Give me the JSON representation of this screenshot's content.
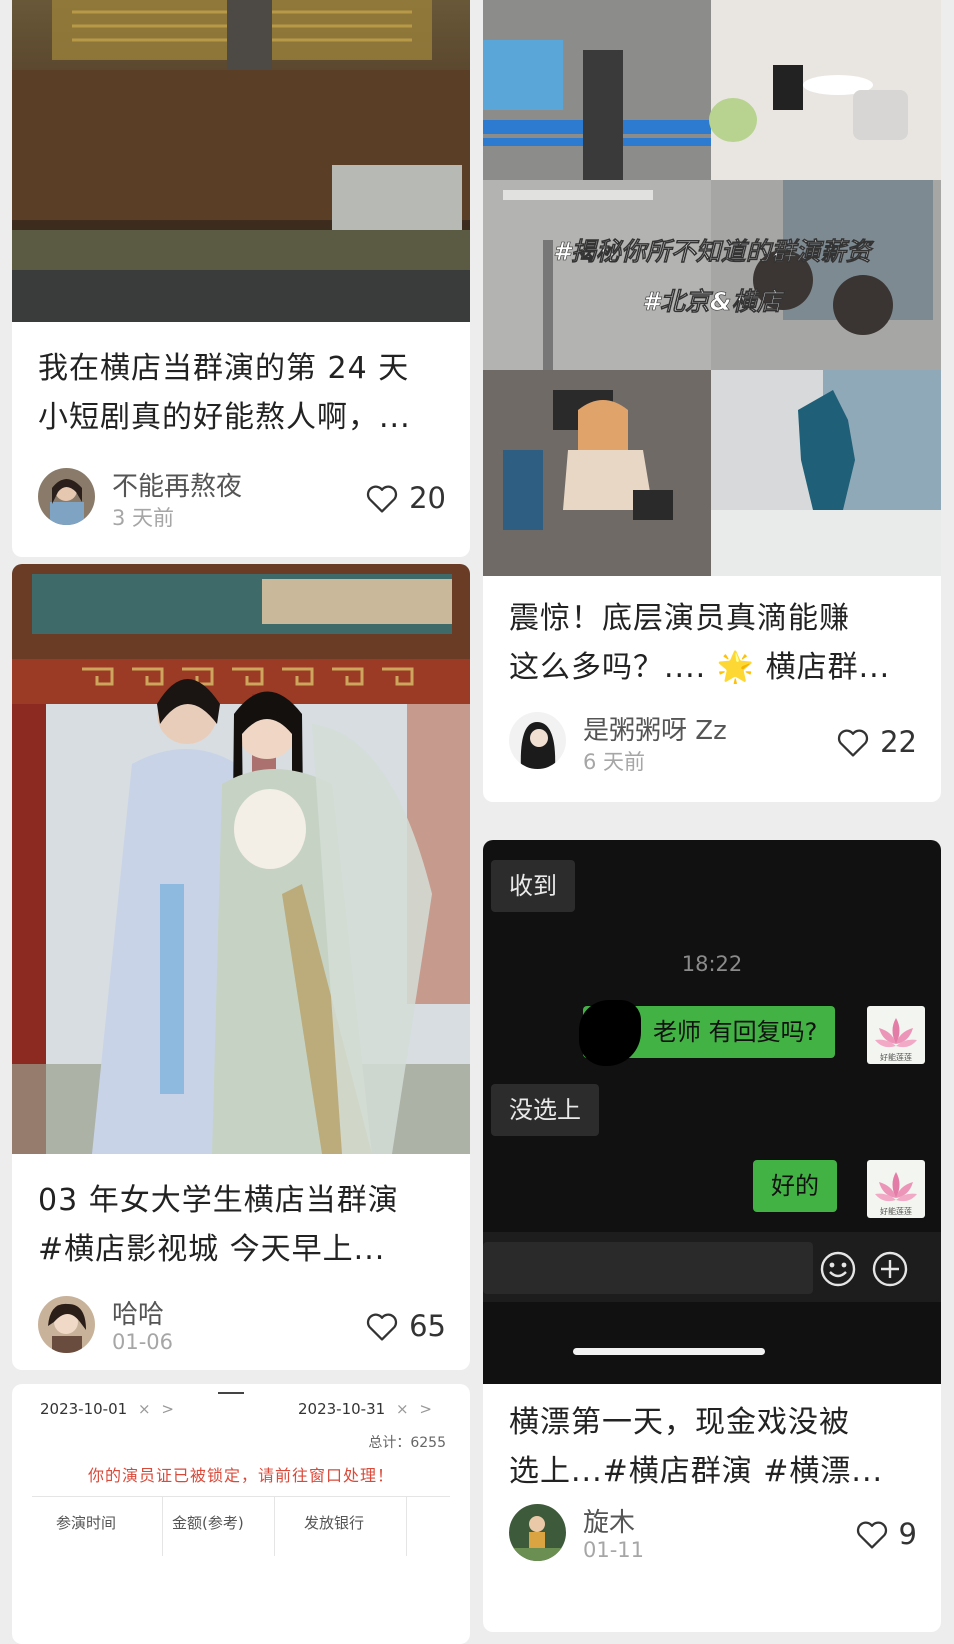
{
  "feed": {
    "left": [
      {
        "title_lines": [
          "我在横店当群演的第 24 天",
          "小短剧真的好能熬人啊，..."
        ],
        "author": "不能再熬夜",
        "date": "3 天前",
        "likes": "20"
      },
      {
        "title_lines": [
          "03 年女大学生横店当群演",
          "#横店影视城  今天早上..."
        ],
        "author": "哈哈",
        "date": "01-06",
        "likes": "65"
      }
    ],
    "right": [
      {
        "image_captions": [
          "#揭秘你所不知道的群演薪资",
          "#北京&横店"
        ],
        "title_lines": [
          "震惊！底层演员真滴能赚",
          "这么多吗？.... 🌟 横店群..."
        ],
        "author": "是粥粥呀 Zz",
        "date": "6 天前",
        "likes": "22"
      },
      {
        "title_lines": [
          "横漂第一天，现金戏没被",
          "选上...#横店群演 #横漂..."
        ],
        "author": "旋木",
        "date": "01-11",
        "likes": "9"
      }
    ]
  },
  "chat": {
    "msg1": "收到",
    "time": "18:22",
    "msg2": "老师 有回复吗?",
    "msg3": "没选上",
    "msg4": "好的",
    "avatar_caption": "好能莲莲",
    "icons": [
      "emoji-icon",
      "plus-circle-icon"
    ]
  },
  "ticket": {
    "start_date": "2023-10-01",
    "end_date": "2023-10-31",
    "clear_glyph": "×",
    "arrow_glyph": ">",
    "total": "总计：6255",
    "warning": "你的演员证已被锁定，请前往窗口处理！",
    "columns": [
      "参演时间",
      "金额(参考)",
      "发放银行"
    ]
  },
  "colors": {
    "wechat_green": "#43b244",
    "warning_red": "#d94a3a"
  }
}
